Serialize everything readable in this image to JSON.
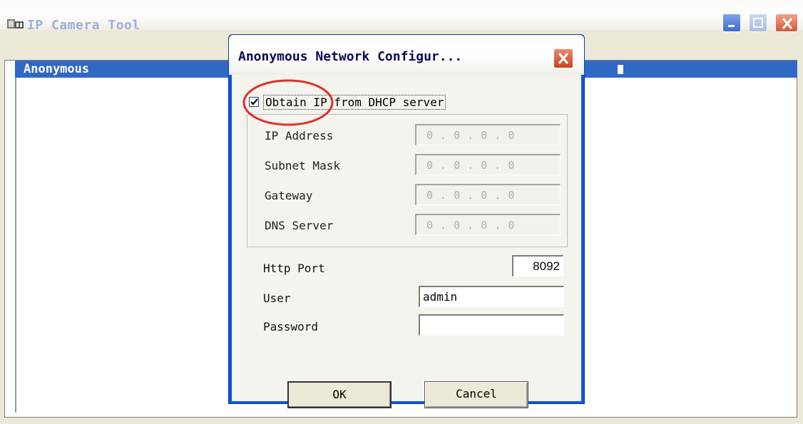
{
  "main_window": {
    "title": "IP Camera Tool",
    "list_header": "Anonymous"
  },
  "dialog": {
    "title": "Anonymous Network Configur...",
    "dhcp_label": "Obtain IP from DHCP server",
    "dhcp_checked": true,
    "ip_fields": [
      {
        "label": "IP Address",
        "value": "0 . 0 . 0 . 0"
      },
      {
        "label": "Subnet Mask",
        "value": "0 . 0 . 0 . 0"
      },
      {
        "label": "Gateway",
        "value": "0 . 0 . 0 . 0"
      },
      {
        "label": "DNS Server",
        "value": "0 . 0 . 0 . 0"
      }
    ],
    "http_port_label": "Http Port",
    "http_port_value": "8092",
    "user_label": "User",
    "user_value": "admin",
    "password_label": "Password",
    "password_value": "",
    "ok_label": "OK",
    "cancel_label": "Cancel"
  },
  "colors": {
    "selection_blue": "#3168c5",
    "dialog_frame": "#0b55e3",
    "highlight_red": "#e0302a",
    "close_red": "#d45a3c"
  },
  "icons": [
    "app-icon",
    "minimize-icon",
    "maximize-icon",
    "close-icon",
    "dialog-close-icon",
    "checkmark-icon"
  ]
}
